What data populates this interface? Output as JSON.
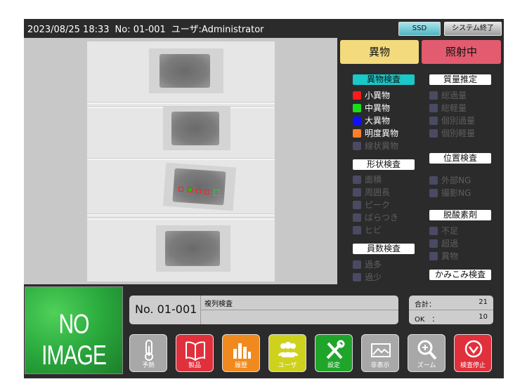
{
  "header": {
    "datetime": "2023/08/25 18:33",
    "number": "No: 01-001",
    "user": "ユーザ:Administrator",
    "ssd_label": "SSD",
    "exit_label": "システム終了"
  },
  "status": {
    "foreign": "異物",
    "irradiating": "照射中"
  },
  "inspection": {
    "foreign_title": "異物検査",
    "foreign_items": [
      {
        "label": "小異物",
        "color": "#ff1a1a",
        "active": true
      },
      {
        "label": "中異物",
        "color": "#18e018",
        "active": true
      },
      {
        "label": "大異物",
        "color": "#1010ff",
        "active": true
      },
      {
        "label": "明度異物",
        "color": "#ff7f2a",
        "active": true
      },
      {
        "label": "線状異物",
        "active": false
      }
    ],
    "shape_title": "形状検査",
    "shape_items": [
      "面積",
      "周囲長",
      "ピーク",
      "ばらつき",
      "ヒビ"
    ],
    "count_title": "員数検査",
    "count_items": [
      "過多",
      "過少"
    ],
    "mass_title": "質量推定",
    "mass_items": [
      "総過量",
      "総軽量",
      "個別過量",
      "個別軽量"
    ],
    "position_title": "位置検査",
    "position_items": [
      "外部NG",
      "撮影NG"
    ],
    "oxygen_title": "脱酸素剤",
    "oxygen_items": [
      "不足",
      "超過",
      "異物"
    ],
    "bite_title": "かみこみ検査"
  },
  "noimage": "NO IMAGE",
  "product": {
    "number": "No. 01-001",
    "name": "複列検査"
  },
  "counts": {
    "total_label": "合計：",
    "total_value": "21",
    "ok_label": "OK　：",
    "ok_value": "10"
  },
  "buttons": [
    {
      "label": "予熱",
      "color": "#a8a8a8",
      "icon": "thermometer-icon"
    },
    {
      "label": "製品",
      "color": "#e0303c",
      "icon": "book-icon"
    },
    {
      "label": "履歴",
      "color": "#f08a1e",
      "icon": "bar-chart-icon"
    },
    {
      "label": "ユーザ",
      "color": "#cfd21d",
      "icon": "users-icon"
    },
    {
      "label": "設定",
      "color": "#1fa52a",
      "icon": "tools-icon"
    },
    {
      "label": "非表示",
      "color": "#a8a8a8",
      "icon": "hide-icon"
    },
    {
      "label": "ズーム",
      "color": "#a8a8a8",
      "icon": "zoom-icon"
    },
    {
      "label": "検査停止",
      "color": "#e0303c",
      "icon": "stop-icon"
    }
  ]
}
